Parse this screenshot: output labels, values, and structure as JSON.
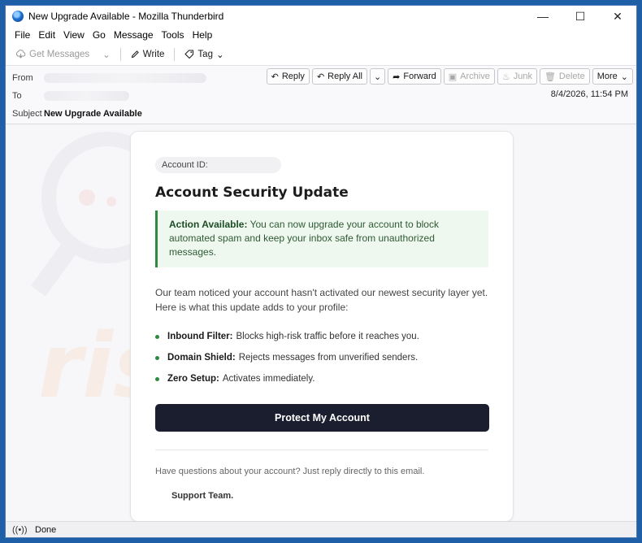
{
  "window": {
    "title": "New Upgrade Available - Mozilla Thunderbird"
  },
  "menu": {
    "file": "File",
    "edit": "Edit",
    "view": "View",
    "go": "Go",
    "message": "Message",
    "tools": "Tools",
    "help": "Help"
  },
  "toolbar": {
    "get_messages": "Get Messages",
    "write": "Write",
    "tag": "Tag"
  },
  "header": {
    "from_label": "From",
    "to_label": "To",
    "subject_label": "Subject",
    "subject": "New Upgrade Available",
    "date": "8/4/2026, 11:54 PM",
    "actions": {
      "reply": "Reply",
      "reply_all": "Reply All",
      "forward": "Forward",
      "archive": "Archive",
      "junk": "Junk",
      "delete": "Delete",
      "more": "More"
    }
  },
  "email": {
    "account_id_label": "Account ID:",
    "title": "Account Security Update",
    "alert_strong": "Action Available:",
    "alert_text": "You can now upgrade your account to block automated spam and keep your inbox safe from unauthorized messages.",
    "intro": "Our team noticed your account hasn't activated our newest security layer yet. Here is what this update adds to your profile:",
    "features": [
      {
        "name": "Inbound Filter:",
        "desc": "Blocks high-risk traffic before it reaches you."
      },
      {
        "name": "Domain Shield:",
        "desc": "Rejects messages from unverified senders."
      },
      {
        "name": "Zero Setup:",
        "desc": "Activates immediately."
      }
    ],
    "cta": "Protect My Account",
    "questions": "Have questions about your account? Just reply directly to this email.",
    "signoff": "Support Team."
  },
  "status": {
    "text": "Done"
  },
  "watermark": {
    "text": "risk.com"
  },
  "colors": {
    "accent_green": "#2e8b3e",
    "cta_bg": "#1b1e2e",
    "window_border": "#1f5fa8"
  }
}
